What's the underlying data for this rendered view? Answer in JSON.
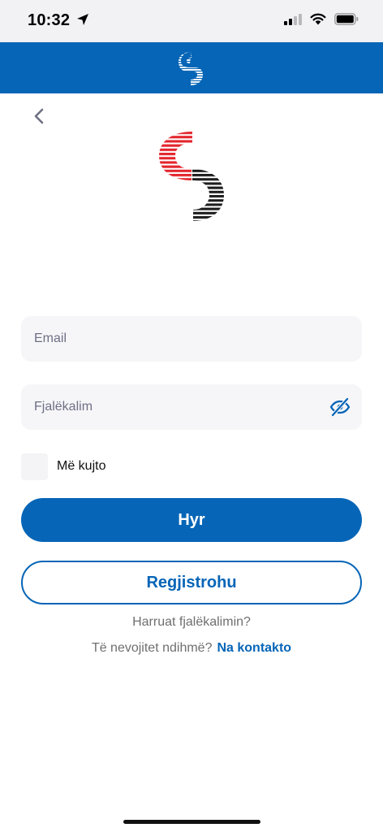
{
  "status_bar": {
    "time": "10:32"
  },
  "login": {
    "email_placeholder": "Email",
    "password_placeholder": "Fjalëkalim",
    "remember_label": "Më kujto",
    "login_button": "Hyr",
    "register_button": "Regjistrohu",
    "forgot_password": "Harruat fjalëkalimin?",
    "help_text": "Të nevojitet ndihmë?",
    "contact_link": "Na kontakto"
  },
  "icons": {
    "back": "chevron-left-icon",
    "password_toggle": "eye-off-icon"
  },
  "colors": {
    "primary": "#0665b7",
    "logo_red": "#e3262d",
    "logo_black": "#1d1d1d",
    "field_background": "#f6f6f8"
  }
}
